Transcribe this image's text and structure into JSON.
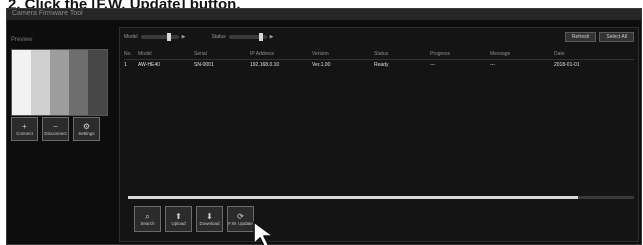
{
  "instruction": "2. Click the [F.W. Update] button.",
  "window": {
    "title": "Camera Firmware Tool"
  },
  "left_panel": {
    "label": "Preview",
    "preview_colors": [
      "#f2f2f2",
      "#cfcfcf",
      "#9d9d9d",
      "#6e6e6e",
      "#474747"
    ],
    "buttons": [
      {
        "label": "Connect",
        "icon": "plus-icon"
      },
      {
        "label": "Disconnect",
        "icon": "minus-icon"
      },
      {
        "label": "Settings",
        "icon": "gear-icon"
      }
    ]
  },
  "main_panel": {
    "filter": {
      "label1": "Model",
      "label2": "Status"
    },
    "buttons": [
      "Refresh",
      "Select All"
    ],
    "table": {
      "headers": [
        "No.",
        "Model",
        "Serial",
        "IP Address",
        "Version",
        "Status",
        "Progress",
        "Message",
        "Date"
      ],
      "rows": [
        [
          "1",
          "AW-HE40",
          "SN-0001",
          "192.168.0.10",
          "Ver.1.00",
          "Ready",
          "---",
          "---",
          "2018-01-01"
        ]
      ]
    },
    "progress_value": 0.89,
    "bottom_buttons": [
      {
        "label": "Search",
        "icon": "search-icon"
      },
      {
        "label": "Upload",
        "icon": "upload-icon"
      },
      {
        "label": "Download",
        "icon": "download-icon"
      },
      {
        "label": "F.W. Update",
        "icon": "update-icon"
      }
    ]
  }
}
